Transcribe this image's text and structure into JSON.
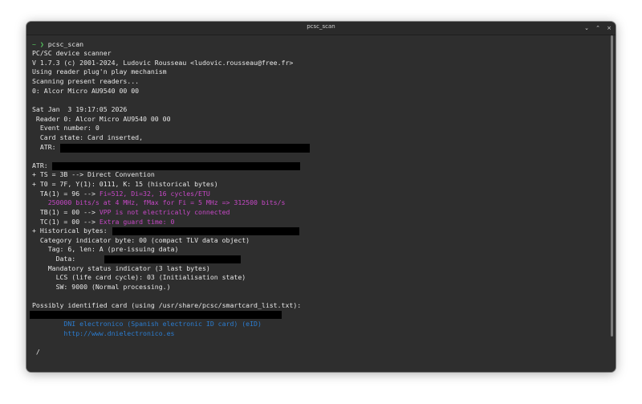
{
  "window": {
    "title": "pcsc_scan",
    "controls": {
      "minimize": "⌄",
      "maximize": "⌃",
      "close": "×"
    }
  },
  "terminal": {
    "prompt_symbol": "~ ❯ ",
    "command": "pcsc_scan",
    "lines": {
      "l1": "PC/SC device scanner",
      "l2": "V 1.7.3 (c) 2001-2024, Ludovic Rousseau <ludovic.rousseau@free.fr>",
      "l3": "Using reader plug'n play mechanism",
      "l4": "Scanning present readers...",
      "l5": "0: Alcor Micro AU9540 00 00",
      "l6": "Sat Jan  3 19:17:05 2026",
      "l7": " Reader 0: Alcor Micro AU9540 00 00",
      "l8": "  Event number: 0",
      "l9": "  Card state: Card inserted,",
      "l10": "  ATR: ",
      "l11": "ATR: ",
      "l12": "+ TS = 3B --> Direct Convention",
      "l13": "+ T0 = 7F, Y(1): 0111, K: 15 (historical bytes)",
      "l14a": "  TA(1) = 96 --> ",
      "l14b": "Fi=512, Di=32, 16 cycles/ETU",
      "l15": "    250000 bits/s at 4 MHz, fMax for Fi = 5 MHz => 312500 bits/s",
      "l16a": "  TB(1) = 00 --> ",
      "l16b": "VPP is not electrically connected",
      "l17a": "  TC(1) = 00 --> ",
      "l17b": "Extra guard time: 0",
      "l18": "+ Historical bytes: ",
      "l19": "  Category indicator byte: 00 (compact TLV data object)",
      "l20": "    Tag: 6, len: A (pre-issuing data)",
      "l21": "      Data: ",
      "l22": "    Mandatory status indicator (3 last bytes)",
      "l23": "      LCS (life card cycle): 03 (Initialisation state)",
      "l24": "      SW: 9000 (Normal processing.)",
      "l25": "Possibly identified card (using /usr/share/pcsc/smartcard_list.txt):",
      "l26": "        DNI electronico (Spanish electronic ID card) (eID)",
      "l27": "        http://www.dnielectronico.es",
      "spinner": " /"
    }
  }
}
